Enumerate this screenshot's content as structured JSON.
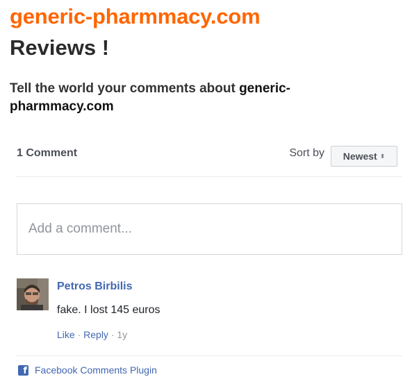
{
  "page": {
    "site_title": "generic-pharmmacy.com",
    "heading": "Reviews !",
    "tell_prefix": "Tell the world your comments about",
    "tell_site": "generic-pharmmacy.com"
  },
  "comments_plugin": {
    "count_label": "1 Comment",
    "sort_label": "Sort by",
    "sort_selected": "Newest",
    "input_placeholder": "Add a comment...",
    "comments": [
      {
        "author": "Petros Birbilis",
        "text": "fake. I lost 145 euros",
        "like_label": "Like",
        "reply_label": "Reply",
        "time": "1y"
      }
    ],
    "footer_label": "Facebook Comments Plugin"
  },
  "icons": {
    "sort": "sort-arrows-icon",
    "facebook": "facebook-icon"
  },
  "colors": {
    "brand_orange": "#ff6600",
    "facebook_blue": "#4267b2",
    "muted_gray": "#90949c"
  }
}
